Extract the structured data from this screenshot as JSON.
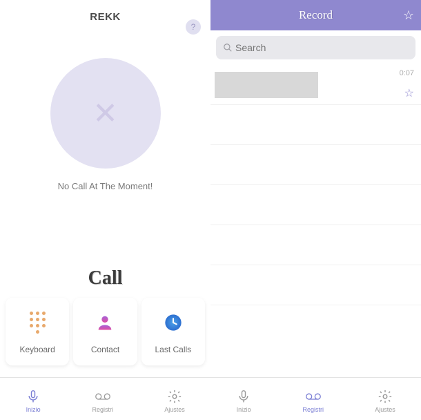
{
  "left": {
    "title": "REKK",
    "no_call_text": "No Call At The Moment!",
    "call_label": "Call",
    "cards": {
      "keyboard": {
        "label": "Keyboard"
      },
      "contact": {
        "label": "Contact"
      },
      "last_calls": {
        "label": "Last Calls"
      }
    },
    "nav": {
      "inizio": "Inizio",
      "registri": "Registri",
      "ajustes": "Ajustes"
    }
  },
  "right": {
    "title": "Record",
    "search_placeholder": "Search",
    "items": [
      {
        "duration": "0:07"
      }
    ],
    "nav": {
      "inizio": "Inizio",
      "registri": "Registri",
      "ajustes": "Ajustes"
    }
  }
}
